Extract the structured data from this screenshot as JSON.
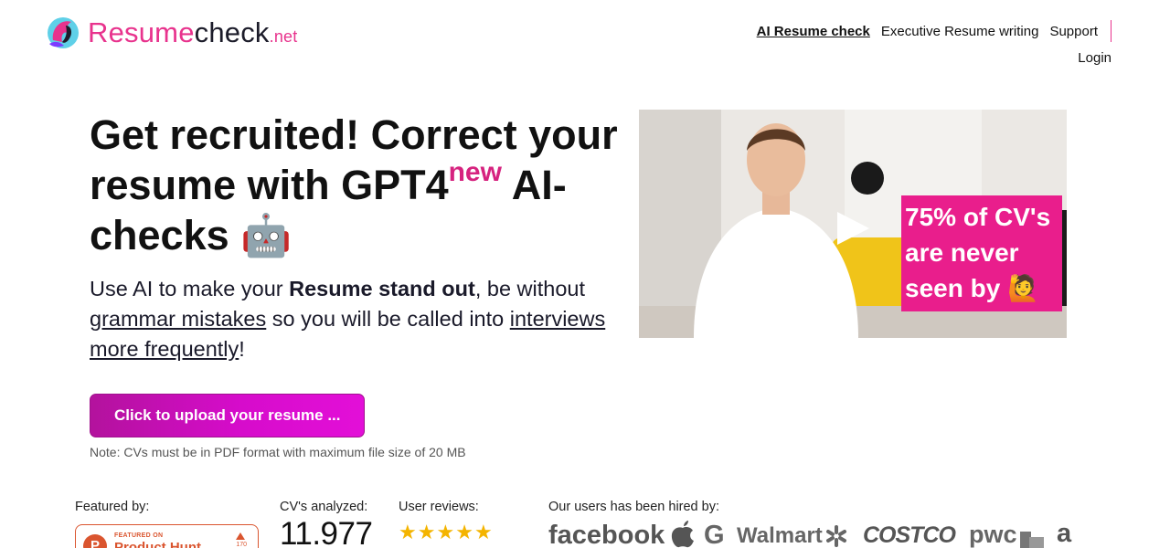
{
  "header": {
    "logo": {
      "part1": "Resume",
      "part2": "check",
      "part3": ".net"
    },
    "nav": [
      {
        "label": "AI Resume check",
        "active": true
      },
      {
        "label": "Executive Resume writing",
        "active": false
      },
      {
        "label": "Support",
        "active": false
      }
    ],
    "login_label": "Login"
  },
  "hero": {
    "title_before": "Get recruited! Correct your resume with GPT4",
    "title_sup": "new",
    "title_after": " AI-checks 🤖",
    "sub_text1": "Use AI to make your ",
    "sub_bold": "Resume stand out",
    "sub_text2": ", be without ",
    "sub_link1": "grammar mistakes",
    "sub_text3": " so you will be called into ",
    "sub_link2": "interviews more frequently",
    "sub_text4": "!",
    "upload_label": "Click to upload your resume ...",
    "note": "Note: CVs must be in PDF format with maximum file size of 20 MB"
  },
  "video": {
    "caption": "75% of CV's are never seen by 🙋",
    "play_icon": "play-icon"
  },
  "stats": {
    "featured_label": "Featured by:",
    "producthunt": {
      "featured": "FEATURED ON",
      "name": "Product Hunt",
      "letter": "P",
      "votes": "170"
    },
    "cv_label": "CV's analyzed:",
    "cv_count": "11.977",
    "reviews_label": "User reviews:",
    "stars": 5,
    "hired_label": "Our users has been hired by:",
    "companies": [
      "facebook",
      "apple",
      "G",
      "Walmart",
      "COSTCO",
      "pwc",
      "a"
    ]
  },
  "colors": {
    "brand_pink": "#e8338d",
    "button": "#d60ccb",
    "star": "#f4b400"
  }
}
